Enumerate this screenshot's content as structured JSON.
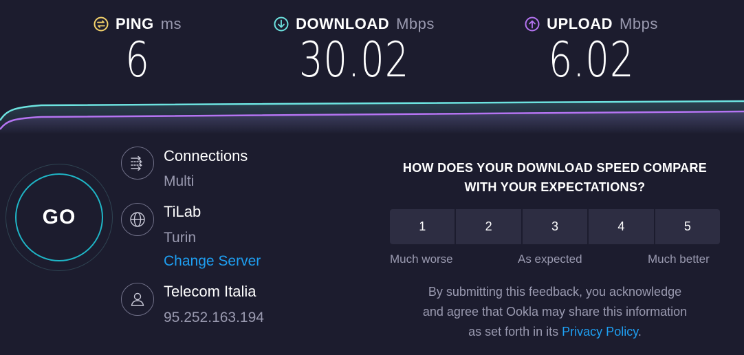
{
  "metrics": {
    "ping": {
      "label": "PING",
      "unit": "ms",
      "value": "6",
      "color": "#f5d36b"
    },
    "download": {
      "label": "DOWNLOAD",
      "unit": "Mbps",
      "value": "30.02",
      "color": "#6de3e0"
    },
    "upload": {
      "label": "UPLOAD",
      "unit": "Mbps",
      "value": "6.02",
      "color": "#b574f2"
    }
  },
  "go_label": "GO",
  "connections": {
    "title": "Connections",
    "value": "Multi"
  },
  "server": {
    "name": "TiLab",
    "location": "Turin",
    "change_label": "Change Server"
  },
  "isp": {
    "name": "Telecom Italia",
    "ip": "95.252.163.194"
  },
  "feedback": {
    "question_line1": "HOW DOES YOUR DOWNLOAD SPEED COMPARE",
    "question_line2": "WITH YOUR EXPECTATIONS?",
    "options": [
      "1",
      "2",
      "3",
      "4",
      "5"
    ],
    "scale_low": "Much worse",
    "scale_mid": "As expected",
    "scale_high": "Much better",
    "disclaimer_line1": "By submitting this feedback, you acknowledge",
    "disclaimer_line2": "and agree that Ookla may share this information",
    "disclaimer_line3_prefix": "as set forth in its",
    "privacy_link": "Privacy Policy",
    "disclaimer_suffix": "."
  },
  "colors": {
    "background": "#1c1c2e",
    "accent_link": "#1e9ff2",
    "go_ring": "#1fb6c7"
  }
}
